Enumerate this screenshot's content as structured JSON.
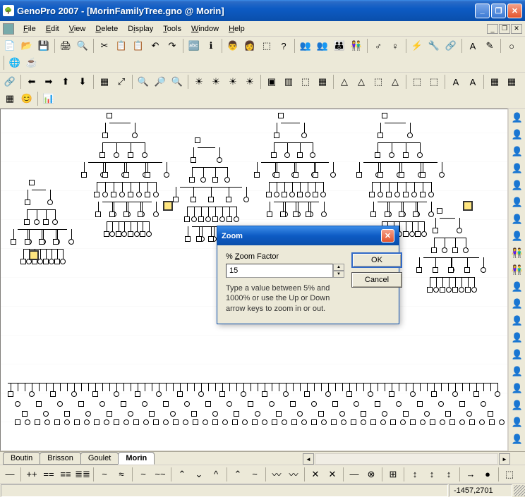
{
  "window": {
    "title": "GenoPro 2007 - [MorinFamilyTree.gno @ Morin]",
    "controls": {
      "min": "_",
      "max": "❐",
      "close": "✕"
    }
  },
  "menu": {
    "items": [
      {
        "label": "File",
        "u": "F"
      },
      {
        "label": "Edit",
        "u": "E"
      },
      {
        "label": "View",
        "u": "V"
      },
      {
        "label": "Delete",
        "u": "D"
      },
      {
        "label": "Display",
        "u": "i"
      },
      {
        "label": "Tools",
        "u": "T"
      },
      {
        "label": "Window",
        "u": "W"
      },
      {
        "label": "Help",
        "u": "H"
      }
    ],
    "mdi": {
      "min": "_",
      "restore": "❐",
      "close": "✕"
    }
  },
  "toolbars": {
    "row1": [
      "📄",
      "📂",
      "💾",
      "",
      "🖨",
      "🔍",
      "",
      "✂",
      "📋",
      "📋",
      "↶",
      "↷",
      "",
      "🔤",
      "ℹ",
      "",
      "👨",
      "👩",
      "⬚",
      "?",
      "",
      "👥",
      "👥",
      "👪",
      "👫",
      "",
      "♂",
      "♀",
      "",
      "⚡",
      "🔧",
      "🔗",
      "",
      "A",
      "✎",
      "",
      "○",
      "",
      "🌐",
      "☕"
    ],
    "row2": [
      "🔗",
      "",
      "⬅",
      "➡",
      "⬆",
      "⬇",
      "",
      "▦",
      "⤢",
      "",
      "🔍",
      "🔎",
      "🔍",
      "",
      "☀",
      "☀",
      "☀",
      "☀",
      "",
      "▣",
      "▥",
      "⬚",
      "▦",
      "",
      "△",
      "△",
      "⬚",
      "△",
      "",
      "⬚",
      "⬚",
      "",
      "A",
      "A",
      "",
      "▦",
      "▦",
      "▦",
      "😊",
      "",
      "📊"
    ]
  },
  "right_toolbar": [
    "👤",
    "👤",
    "👤",
    "👤",
    "👤",
    "👤",
    "👤",
    "👤",
    "👫",
    "👫",
    "👤",
    "👤",
    "👤",
    "👤",
    "👤",
    "👤",
    "👤",
    "👤",
    "👤",
    "👤"
  ],
  "tabs": {
    "items": [
      "Boutin",
      "Brisson",
      "Goulet",
      "Morin"
    ],
    "active": 3
  },
  "bottom_toolbar": [
    "—",
    "",
    "++",
    "==",
    "≡≡",
    "≣≣",
    "",
    "~",
    "≈",
    "",
    "~",
    "~~",
    "",
    "⌃",
    "⌄",
    "^",
    "",
    "⌃",
    "~",
    "",
    "〰",
    "〰",
    "",
    "✕",
    "✕",
    "",
    "—",
    "⊗",
    "",
    "⊞",
    "",
    "↕",
    "↕",
    "↕",
    "",
    "→",
    "●",
    "",
    "⬚"
  ],
  "status": {
    "coords": "-1457,2701"
  },
  "dialog": {
    "title": "Zoom",
    "label": "% Zoom Factor",
    "label_u": "Z",
    "value": "15",
    "hint": "Type a value between 5% and 1000% or use the Up or Down arrow keys to zoom in or out.",
    "ok": "OK",
    "cancel": "Cancel",
    "close": "✕"
  },
  "canvas": {
    "note": "PostLabel"
  }
}
